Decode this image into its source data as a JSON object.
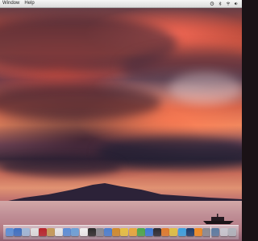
{
  "menubar": {
    "items": [
      "Window",
      "Help"
    ]
  },
  "status_icons": [
    "time-machine-icon",
    "bluetooth-icon",
    "wifi-icon",
    "volume-icon"
  ],
  "dock": {
    "apps": [
      {
        "name": "finder-icon",
        "color": "#5a8fd8"
      },
      {
        "name": "compass-icon",
        "color": "#3c6fc2"
      },
      {
        "name": "mail-icon",
        "color": "#9fb8d8"
      },
      {
        "name": "calendar-icon",
        "color": "#e0e0e0"
      },
      {
        "name": "photo-booth-icon",
        "color": "#b8232a"
      },
      {
        "name": "address-book-icon",
        "color": "#c59a56"
      },
      {
        "name": "preview-icon",
        "color": "#e8e8e8"
      },
      {
        "name": "itunes-icon",
        "color": "#5b8ed8"
      },
      {
        "name": "iphoto-icon",
        "color": "#6aa0d8"
      },
      {
        "name": "textedit-icon",
        "color": "#f0f0f0"
      },
      {
        "name": "terminal-icon",
        "color": "#2a2a2a"
      },
      {
        "name": "system-preferences-icon",
        "color": "#8a8a90"
      },
      {
        "name": "app-store-icon",
        "color": "#4a7fd0"
      },
      {
        "name": "garageband-icon",
        "color": "#d08a2a"
      },
      {
        "name": "imovie-icon",
        "color": "#e6c040"
      },
      {
        "name": "pages-icon",
        "color": "#e8a83a"
      },
      {
        "name": "numbers-icon",
        "color": "#4aa84a"
      },
      {
        "name": "keynote-icon",
        "color": "#3a7ad8"
      },
      {
        "name": "dashboard-icon",
        "color": "#2a2a30"
      },
      {
        "name": "firefox-icon",
        "color": "#e07a2a"
      },
      {
        "name": "chrome-icon",
        "color": "#e0c040"
      },
      {
        "name": "skype-icon",
        "color": "#3aa0e0"
      },
      {
        "name": "photoshop-icon",
        "color": "#1a3a6a"
      },
      {
        "name": "vlc-icon",
        "color": "#f08a20"
      },
      {
        "name": "utilities-icon",
        "color": "#8a8a90"
      }
    ],
    "tail": [
      {
        "name": "downloads-stack-icon",
        "color": "#5a7aa0"
      },
      {
        "name": "documents-stack-icon",
        "color": "#c8c8d0"
      },
      {
        "name": "trash-icon",
        "color": "#b0b4bc"
      }
    ]
  }
}
